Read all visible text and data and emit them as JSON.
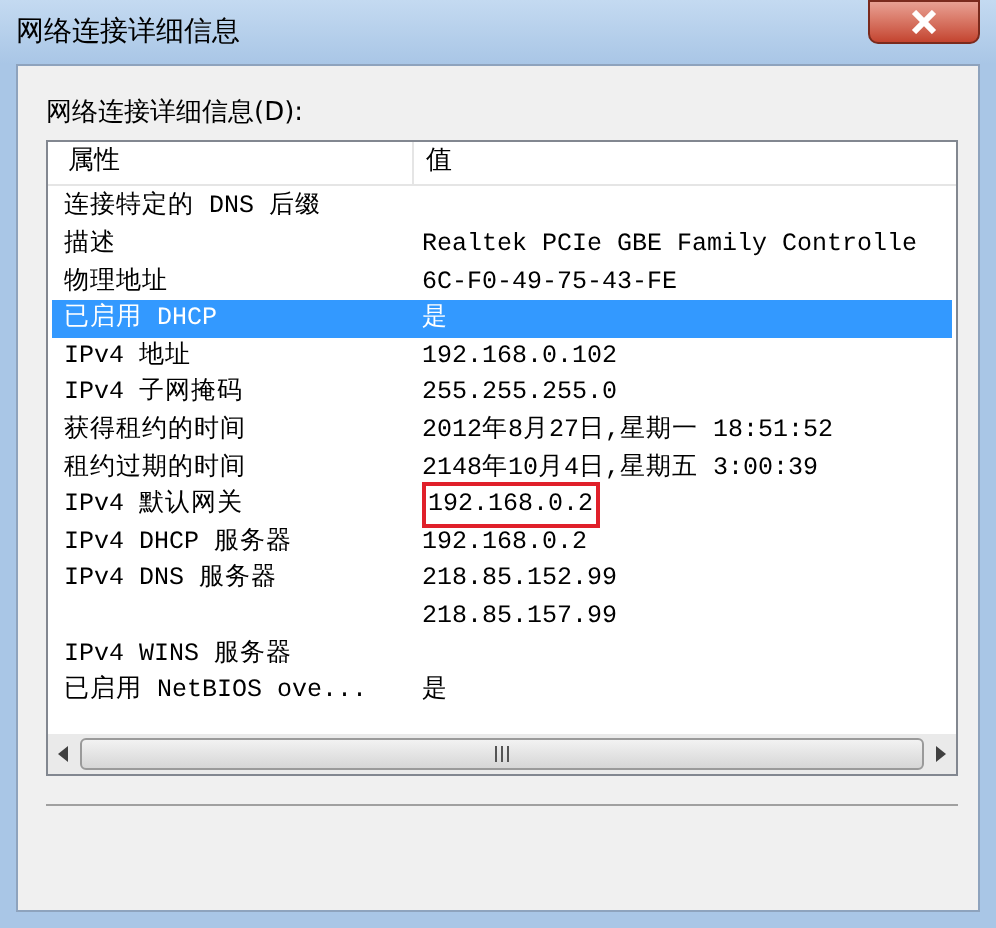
{
  "window": {
    "title": "网络连接详细信息"
  },
  "list_label": "网络连接详细信息(D):",
  "columns": [
    "属性",
    "值"
  ],
  "rows": [
    {
      "property": "连接特定的 DNS 后缀",
      "value": "",
      "selected": false,
      "outlined": false
    },
    {
      "property": "描述",
      "value": "Realtek PCIe GBE Family Controlle",
      "selected": false,
      "outlined": false
    },
    {
      "property": "物理地址",
      "value": "6C-F0-49-75-43-FE",
      "selected": false,
      "outlined": false
    },
    {
      "property": "已启用 DHCP",
      "value": "是",
      "selected": true,
      "outlined": false
    },
    {
      "property": "IPv4 地址",
      "value": "192.168.0.102",
      "selected": false,
      "outlined": false
    },
    {
      "property": "IPv4 子网掩码",
      "value": "255.255.255.0",
      "selected": false,
      "outlined": false
    },
    {
      "property": "获得租约的时间",
      "value": "2012年8月27日,星期一 18:51:52",
      "selected": false,
      "outlined": false
    },
    {
      "property": "租约过期的时间",
      "value": "2148年10月4日,星期五 3:00:39",
      "selected": false,
      "outlined": false
    },
    {
      "property": "IPv4 默认网关",
      "value": "192.168.0.2",
      "selected": false,
      "outlined": true
    },
    {
      "property": "IPv4 DHCP 服务器",
      "value": "192.168.0.2",
      "selected": false,
      "outlined": false
    },
    {
      "property": "IPv4 DNS 服务器",
      "value": "218.85.152.99",
      "selected": false,
      "outlined": false
    },
    {
      "property": "",
      "value": "218.85.157.99",
      "selected": false,
      "outlined": false
    },
    {
      "property": "IPv4 WINS 服务器",
      "value": "",
      "selected": false,
      "outlined": false
    },
    {
      "property": "已启用 NetBIOS ove...",
      "value": "是",
      "selected": false,
      "outlined": false
    }
  ]
}
